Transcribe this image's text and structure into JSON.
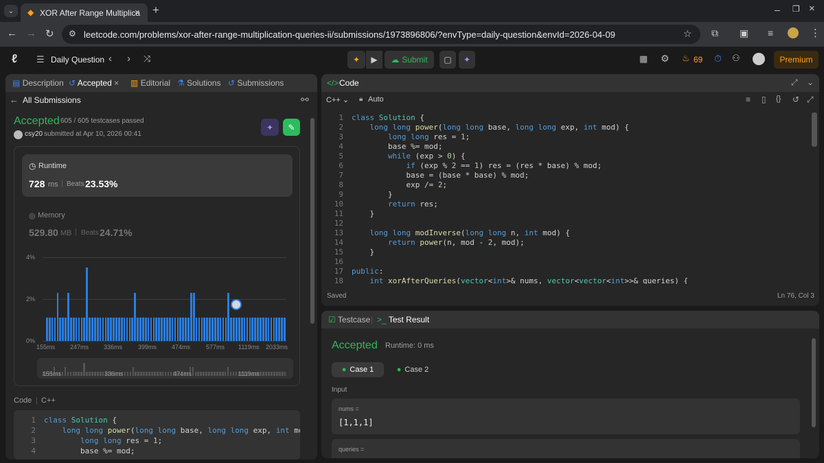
{
  "browser": {
    "tab_title": "XOR After Range Multiplica",
    "url": "leetcode.com/problems/xor-after-range-multiplication-queries-ii/submissions/1973896806/?envType=daily-question&envId=2026-04-09"
  },
  "nav": {
    "daily": "Daily Question",
    "submit": "Submit",
    "streak": "69",
    "premium": "Premium"
  },
  "left_tabs": {
    "description": "Description",
    "accepted": "Accepted",
    "editorial": "Editorial",
    "solutions": "Solutions",
    "submissions": "Submissions"
  },
  "submission": {
    "back": "All Submissions",
    "status": "Accepted",
    "testcases": "605 / 605 testcases passed",
    "user": "csy20",
    "submitted": "submitted at Apr 10, 2026 00:41"
  },
  "runtime": {
    "label": "Runtime",
    "value": "728",
    "unit": "ms",
    "beats_label": "Beats",
    "beats": "23.53%"
  },
  "memory": {
    "label": "Memory",
    "value": "529.80",
    "unit": "MB",
    "beats_label": "Beats",
    "beats": "24.71%"
  },
  "chart_data": {
    "type": "bar",
    "y_ticks": [
      "4%",
      "2%",
      "0%"
    ],
    "x_ticks": [
      "155ms",
      "247ms",
      "336ms",
      "399ms",
      "474ms",
      "577ms",
      "1119ms",
      "2033ms"
    ],
    "mini_ticks": [
      "155ms",
      "336ms",
      "474ms",
      "1119ms"
    ],
    "ylim": [
      0,
      4
    ],
    "values": [
      1.1,
      1.1,
      1.1,
      1.1,
      2.3,
      1.1,
      1.1,
      1.1,
      2.3,
      1.1,
      1.1,
      1.1,
      1.1,
      1.1,
      1.1,
      3.5,
      1.1,
      1.1,
      1.1,
      1.1,
      1.1,
      1.1,
      1.1,
      1.1,
      1.1,
      1.1,
      1.1,
      1.1,
      1.1,
      1.1,
      1.1,
      1.1,
      1.1,
      2.3,
      1.1,
      1.1,
      1.1,
      1.1,
      1.1,
      1.1,
      1.1,
      1.1,
      1.1,
      1.1,
      1.1,
      1.1,
      1.1,
      1.1,
      1.1,
      1.1,
      1.1,
      1.1,
      1.1,
      1.1,
      2.3,
      2.3,
      1.1,
      1.1,
      1.1,
      1.1,
      1.1,
      1.1,
      1.1,
      1.1,
      1.1,
      1.1,
      1.1,
      1.1,
      2.3,
      1.1,
      1.1,
      1.1,
      1.1,
      1.1,
      1.1,
      1.1,
      1.1,
      1.1,
      1.1,
      1.1,
      1.1,
      1.1,
      1.1,
      1.1,
      1.1,
      1.1,
      1.1,
      1.1,
      1.1,
      1.1
    ]
  },
  "code_tab": {
    "code": "Code",
    "lang": "C++"
  },
  "editor": {
    "title": "Code",
    "lang": "C++",
    "auto": "Auto",
    "status": "Saved",
    "position": "Ln 76, Col 3"
  },
  "test": {
    "testcase": "Testcase",
    "result": "Test Result",
    "status": "Accepted",
    "runtime": "Runtime: 0 ms",
    "case1": "Case 1",
    "case2": "Case 2",
    "input": "Input",
    "nums_label": "nums =",
    "nums": "[1,1,1]",
    "queries_label": "queries ="
  }
}
